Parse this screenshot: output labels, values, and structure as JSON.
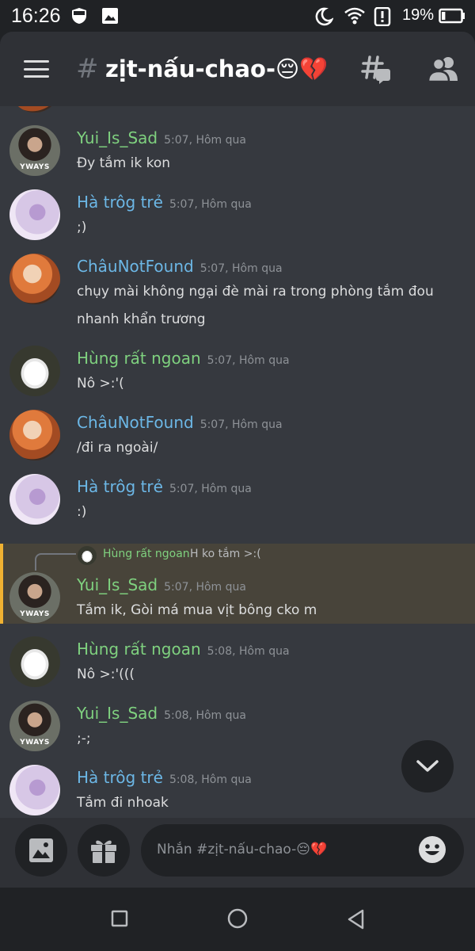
{
  "status_bar": {
    "time": "16:26",
    "battery_percent": "19%",
    "battery_level": 0.19,
    "icons": [
      "shield-icon",
      "image-icon",
      "moon-icon",
      "wifi-icon",
      "alert-icon",
      "battery-icon"
    ]
  },
  "header": {
    "hash": "#",
    "channel_name": "zịt-nấu-chao-😔💔",
    "icons": [
      "menu-icon",
      "threads-icon",
      "members-icon"
    ]
  },
  "messages": [
    {
      "author": "Yui_Is_Sad",
      "time": "5:07, Hôm qua",
      "lines": [
        "Đy tắm ik kon"
      ],
      "avatar_caption": "YWAYS"
    },
    {
      "author": "Hà trôg trẻ",
      "time": "5:07, Hôm qua",
      "lines": [
        ";)"
      ]
    },
    {
      "author": "ChâuNotFound",
      "time": "5:07, Hôm qua",
      "lines": [
        "chụy mài không ngại đè mài ra trong phòng tắm đou",
        "nhanh khẩn trương"
      ]
    },
    {
      "author": "Hùng rất ngoan",
      "time": "5:07, Hôm qua",
      "lines": [
        "Nô >:'("
      ]
    },
    {
      "author": "ChâuNotFound",
      "time": "5:07, Hôm qua",
      "lines": [
        "/đi ra ngoài/"
      ]
    },
    {
      "author": "Hà trôg trẻ",
      "time": "5:07, Hôm qua",
      "lines": [
        ":)"
      ]
    },
    {
      "author": "Yui_Is_Sad",
      "time": "5:07, Hôm qua",
      "lines": [
        "Tắm ik, Gòi má mua vịt bông cko m"
      ],
      "avatar_caption": "YWAYS",
      "reply": {
        "author": "Hùng rất ngoan",
        "text": "H ko tắm >:("
      }
    },
    {
      "author": "Hùng rất ngoan",
      "time": "5:08, Hôm qua",
      "lines": [
        "Nô >:'((("
      ]
    },
    {
      "author": "Yui_Is_Sad",
      "time": "5:08, Hôm qua",
      "lines": [
        ";-;"
      ],
      "avatar_caption": "YWAYS"
    },
    {
      "author": "Hà trôg trẻ",
      "time": "5:08, Hôm qua",
      "lines": [
        "Tắm đi nhoak"
      ]
    }
  ],
  "composer": {
    "placeholder": "Nhắn #zịt-nấu-chao-😔💔",
    "icons": [
      "image-icon",
      "gift-icon",
      "emoji-icon"
    ]
  },
  "nav": {
    "icons": [
      "recents-icon",
      "home-icon",
      "back-icon"
    ]
  },
  "colors": {
    "green_name": "#7fd17f",
    "blue_name": "#6cb7e6",
    "highlight": "#48443a",
    "highlight_bar": "#f0b232"
  }
}
